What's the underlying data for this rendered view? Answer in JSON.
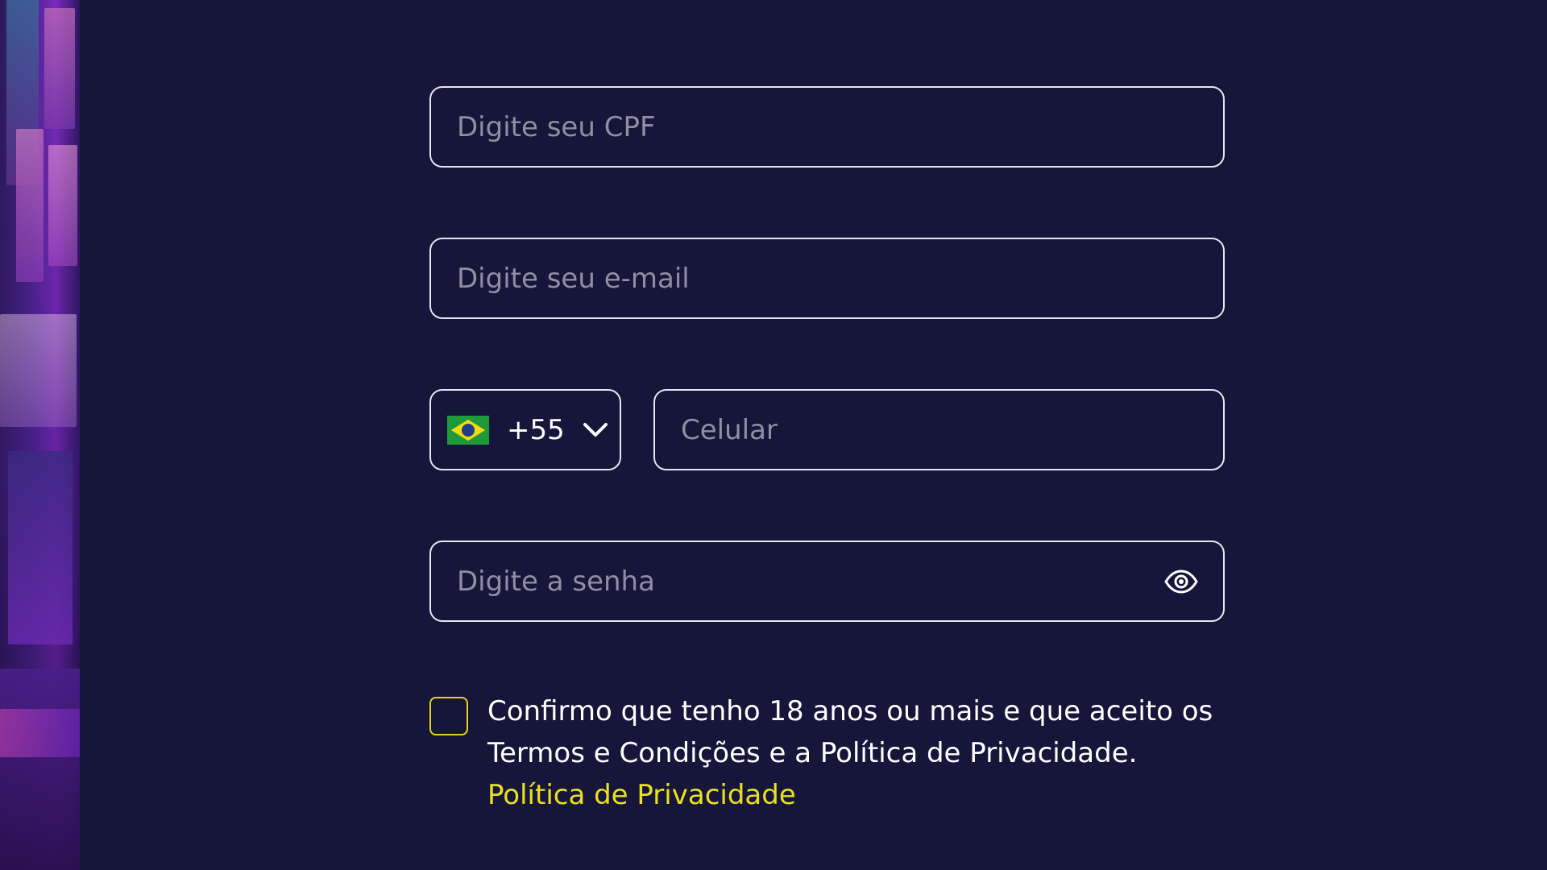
{
  "form": {
    "cpf": {
      "placeholder": "Digite seu CPF"
    },
    "email": {
      "placeholder": "Digite seu e-mail"
    },
    "phone": {
      "country_flag_icon": "brazil-flag-icon",
      "dial_code": "+55",
      "placeholder": "Celular"
    },
    "password": {
      "placeholder": "Digite a senha",
      "toggle_icon": "eye-icon"
    },
    "consent": {
      "text": "Confirmo que tenho 18 anos ou mais e que aceito os Termos e Condições e a Política de Privacidade.",
      "link_label": "Política de Privacidade",
      "checked": false
    }
  },
  "colors": {
    "background": "#16153a",
    "border": "#e7e5ef",
    "placeholder": "#8f8ea3",
    "accent": "#e9e120"
  }
}
